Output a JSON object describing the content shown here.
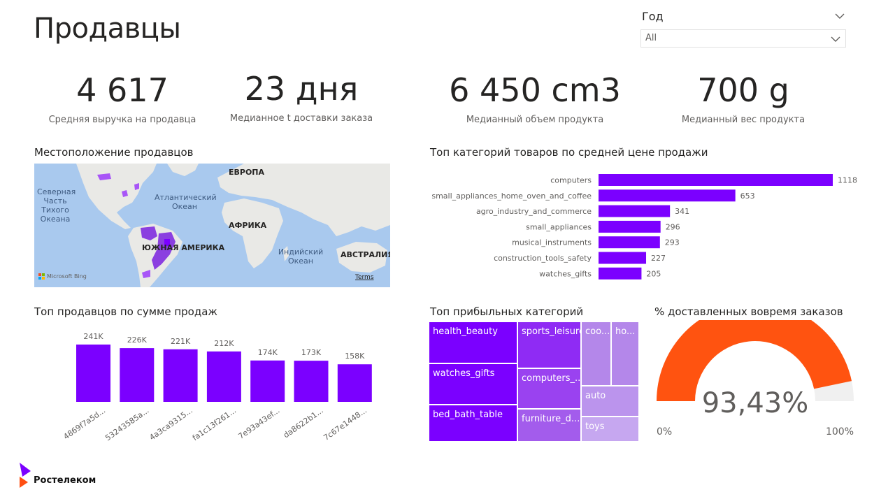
{
  "page": {
    "title": "Продавцы"
  },
  "filter": {
    "label": "Год",
    "value": "All"
  },
  "kpis": [
    {
      "value": "4 617",
      "label": "Средняя выручка на продавца"
    },
    {
      "value": "23 дня",
      "label": "Медианное t доставки заказа"
    },
    {
      "value": "6 450 cm3",
      "label": "Медианный объем продукта"
    },
    {
      "value": "700 g",
      "label": "Медианный вес продукта"
    }
  ],
  "map": {
    "title": "Местоположение продавцов",
    "labels": {
      "europe": "ЕВРОПА",
      "atlantic": "Атлантический Океан",
      "africa": "АФРИКА",
      "south_america": "ЮЖНАЯ АМЕРИКА",
      "indian": "Индийский Океан",
      "australia": "АВСТРАЛИЯ",
      "north_pacific": "Северная Часть Тихого Океана"
    },
    "attribution": "Microsoft Bing",
    "terms": "Terms"
  },
  "colors": {
    "accent": "#7b00ff",
    "gauge_fill": "#ff5310",
    "gauge_track": "#f0f0f0"
  },
  "chart_data": [
    {
      "type": "bar",
      "orientation": "horizontal",
      "title": "Топ категорий товаров по средней цене продажи",
      "categories": [
        "computers",
        "small_appliances_home_oven_and_coffee",
        "agro_industry_and_commerce",
        "small_appliances",
        "musical_instruments",
        "construction_tools_safety",
        "watches_gifts"
      ],
      "values": [
        1118,
        653,
        341,
        296,
        293,
        227,
        205
      ],
      "value_labels": [
        "1118",
        "653",
        "341",
        "296",
        "293",
        "227",
        "205"
      ]
    },
    {
      "type": "bar",
      "title": "Топ продавцов по сумме продаж",
      "categories": [
        "4869f7a5d...",
        "53243585a...",
        "4a3ca9315...",
        "fa1c13f261...",
        "7e93a43ef...",
        "da8622b1...",
        "7c67e1448..."
      ],
      "values": [
        241,
        226,
        221,
        212,
        174,
        173,
        158
      ],
      "value_labels": [
        "241K",
        "226K",
        "221K",
        "212K",
        "174K",
        "173K",
        "158K"
      ]
    },
    {
      "type": "treemap",
      "title": "Топ прибыльных категорий",
      "items": [
        "health_beauty",
        "watches_gifts",
        "bed_bath_table",
        "sports_leisure",
        "computers_...",
        "furniture_d...",
        "coo...",
        "ho...",
        "auto",
        "toys"
      ]
    },
    {
      "type": "gauge",
      "title": "% доставленных вовремя заказов",
      "value": 93.43,
      "value_label": "93,43%",
      "min_label": "0%",
      "max_label": "100%",
      "min": 0,
      "max": 100
    }
  ],
  "brand": {
    "name": "Ростелеком"
  }
}
